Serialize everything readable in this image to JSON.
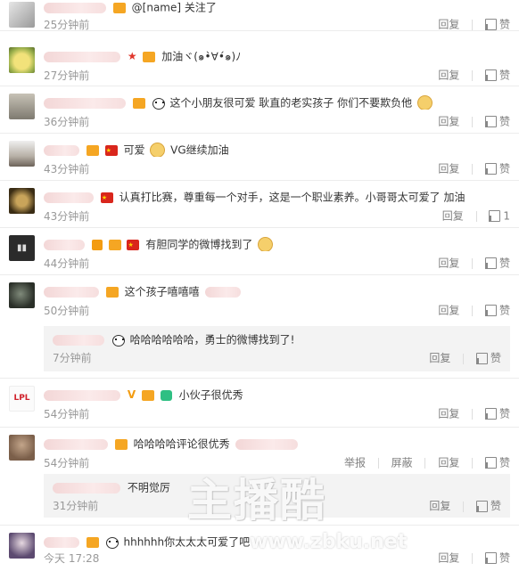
{
  "actions": {
    "reply": "回复",
    "like": "赞",
    "report": "举报",
    "block": "屏蔽"
  },
  "comments": [
    {
      "text": "@[name] 关注了",
      "time": "25分钟前",
      "likes": ""
    },
    {
      "text": "加油ヾ(๑•̀∀•́๑)ﾉ",
      "time": "27分钟前",
      "likes": ""
    },
    {
      "text": "这个小朋友很可爱 耿直的老实孩子 你们不要欺负他",
      "time": "36分钟前",
      "likes": ""
    },
    {
      "text": "可爱",
      "text2": "VG继续加油",
      "time": "43分钟前",
      "likes": ""
    },
    {
      "text": "认真打比赛，尊重每一个对手，这是一个职业素养。小哥哥太可爱了 加油",
      "time": "43分钟前",
      "likes": "1"
    },
    {
      "text": "有胆同学的微博找到了",
      "time": "44分钟前",
      "likes": ""
    },
    {
      "text": "这个孩子嘻嘻嘻",
      "time": "50分钟前",
      "likes": ""
    },
    {
      "text": "小伙子很优秀",
      "time": "54分钟前",
      "likes": ""
    },
    {
      "text": "哈哈哈哈评论很优秀",
      "time": "54分钟前",
      "likes": ""
    },
    {
      "text": "hhhhhh你太太太可爱了吧",
      "time": "今天 17:28",
      "likes": ""
    }
  ],
  "replies": [
    {
      "text": "哈哈哈哈哈哈，勇士的微博找到了!",
      "time": "7分钟前"
    },
    {
      "text": "不明觉厉",
      "time": "31分钟前"
    }
  ],
  "watermark": {
    "main": "主播酷",
    "url": "www.zbku.net"
  },
  "colors": {
    "reply_bg": "#f3f3f3",
    "time": "#999999",
    "action": "#808080",
    "vip": "#f5a623"
  }
}
